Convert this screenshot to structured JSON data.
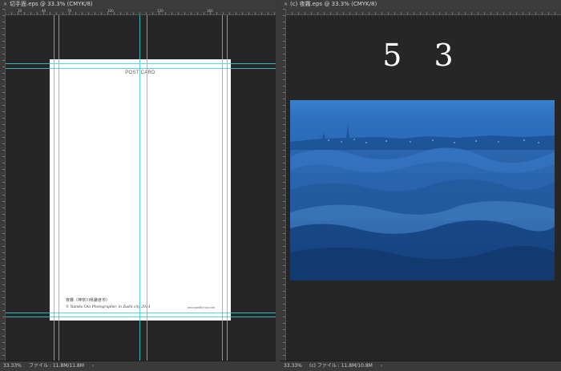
{
  "left_window": {
    "tab_title": "切手面.eps @ 33.3% (CMYK/8)",
    "ruler_labels": [
      "10",
      "40",
      "70",
      "100",
      "130",
      "160"
    ],
    "status": {
      "zoom": "33.33%",
      "file_info": "ファイル : 11.8M/11.8M",
      "arrow": "›"
    },
    "postcard": {
      "title": "POST CARD",
      "caption": "夜霧（神奈川県鎌倉市）",
      "credit": "© Yumiko Ota Photographer, in Zushi city 2014",
      "url": "www.yumiko-ota.com"
    }
  },
  "right_window": {
    "tab_title": "(c) 夜霧.eps @ 33.3% (CMYK/8)",
    "page_number": "5 3",
    "status": {
      "zoom": "33.33%",
      "file_info": "(c) ファイル : 11.8M/10.8M",
      "arrow": "›"
    }
  },
  "colors": {
    "guide": "#3fd0d8",
    "canvas_bg": "#262626",
    "ui_bar": "#3a3a3a"
  },
  "icons": {
    "tab_close": "close-icon"
  }
}
